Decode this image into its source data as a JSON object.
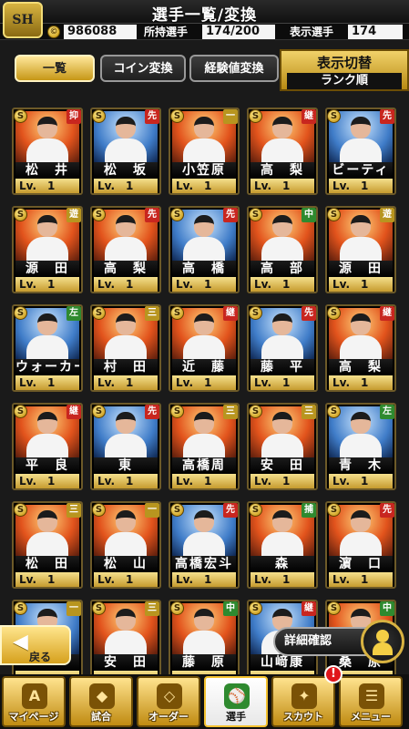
{
  "header": {
    "title": "選手一覧/変換",
    "logo_text": "SH"
  },
  "info": {
    "coin_amount": "986088",
    "owned_label": "所持選手",
    "owned_value": "174/200",
    "display_label": "表示選手",
    "display_value": "174"
  },
  "tabs": [
    {
      "label": "一覧",
      "active": true
    },
    {
      "label": "コイン変換",
      "active": false
    },
    {
      "label": "経験値変換",
      "active": false
    }
  ],
  "toggle": {
    "title": "表示切替",
    "mode": "ランク順"
  },
  "players": [
    {
      "name": "松　井",
      "level": "Lv.　1",
      "position": "抑",
      "pos_color": "#c8261f"
    },
    {
      "name": "松　坂",
      "level": "Lv.　1",
      "position": "先",
      "pos_color": "#c8261f"
    },
    {
      "name": "小笠原",
      "level": "Lv.　1",
      "position": "一",
      "pos_color": "#b8951f"
    },
    {
      "name": "高　梨",
      "level": "Lv.　1",
      "position": "継",
      "pos_color": "#c8261f"
    },
    {
      "name": "ビーティ",
      "level": "Lv.　1",
      "position": "先",
      "pos_color": "#c8261f"
    },
    {
      "name": "源　田",
      "level": "Lv.　1",
      "position": "遊",
      "pos_color": "#b8951f"
    },
    {
      "name": "高　梨",
      "level": "Lv.　1",
      "position": "先",
      "pos_color": "#c8261f"
    },
    {
      "name": "高　橋",
      "level": "Lv.　1",
      "position": "先",
      "pos_color": "#c8261f"
    },
    {
      "name": "高　部",
      "level": "Lv.　1",
      "position": "中",
      "pos_color": "#2f8a2f"
    },
    {
      "name": "源　田",
      "level": "Lv.　1",
      "position": "遊",
      "pos_color": "#b8951f"
    },
    {
      "name": "ウォーカー",
      "level": "Lv.　1",
      "position": "左",
      "pos_color": "#2f8a2f"
    },
    {
      "name": "村　田",
      "level": "Lv.　1",
      "position": "三",
      "pos_color": "#b8951f"
    },
    {
      "name": "近　藤",
      "level": "Lv.　1",
      "position": "継",
      "pos_color": "#c8261f"
    },
    {
      "name": "藤　平",
      "level": "Lv.　1",
      "position": "先",
      "pos_color": "#c8261f"
    },
    {
      "name": "高　梨",
      "level": "Lv.　1",
      "position": "継",
      "pos_color": "#c8261f"
    },
    {
      "name": "平　良",
      "level": "Lv.　1",
      "position": "継",
      "pos_color": "#c8261f"
    },
    {
      "name": "東",
      "level": "Lv.　1",
      "position": "先",
      "pos_color": "#c8261f"
    },
    {
      "name": "高橋周",
      "level": "Lv.　1",
      "position": "三",
      "pos_color": "#b8951f"
    },
    {
      "name": "安　田",
      "level": "Lv.　1",
      "position": "三",
      "pos_color": "#b8951f"
    },
    {
      "name": "青　木",
      "level": "Lv.　1",
      "position": "左",
      "pos_color": "#2f8a2f"
    },
    {
      "name": "松　田",
      "level": "Lv.　1",
      "position": "三",
      "pos_color": "#b8951f"
    },
    {
      "name": "松　山",
      "level": "Lv.　1",
      "position": "一",
      "pos_color": "#b8951f"
    },
    {
      "name": "高橋宏斗",
      "level": "Lv.　1",
      "position": "先",
      "pos_color": "#c8261f"
    },
    {
      "name": "森",
      "level": "Lv.　1",
      "position": "捕",
      "pos_color": "#2f8a2f"
    },
    {
      "name": "濵　口",
      "level": "Lv.　1",
      "position": "先",
      "pos_color": "#c8261f"
    },
    {
      "name": "",
      "level": "",
      "position": "一",
      "pos_color": "#b8951f"
    },
    {
      "name": "安　田",
      "level": "",
      "position": "三",
      "pos_color": "#b8951f"
    },
    {
      "name": "藤　原",
      "level": "",
      "position": "中",
      "pos_color": "#2f8a2f"
    },
    {
      "name": "山﨑康",
      "level": "",
      "position": "継",
      "pos_color": "#c8261f"
    },
    {
      "name": "桑　原",
      "level": "",
      "position": "中",
      "pos_color": "#2f8a2f"
    }
  ],
  "back_button": {
    "label": "戻る"
  },
  "detail_button": {
    "label": "詳細確認"
  },
  "nav": [
    {
      "label": "マイページ",
      "icon": "A",
      "active": false
    },
    {
      "label": "試合",
      "icon": "◆",
      "active": false
    },
    {
      "label": "オーダー",
      "icon": "◇",
      "active": false
    },
    {
      "label": "選手",
      "icon": "⚾",
      "active": true
    },
    {
      "label": "スカウト",
      "icon": "✦",
      "active": false
    },
    {
      "label": "メニュー",
      "icon": "☰",
      "active": false
    }
  ],
  "alert_badge": "!",
  "colors": {
    "accent_gold": "#d6a11d",
    "starter_red": "#c8261f",
    "fielder_gold": "#b8951f",
    "outfield_green": "#2f8a2f"
  }
}
